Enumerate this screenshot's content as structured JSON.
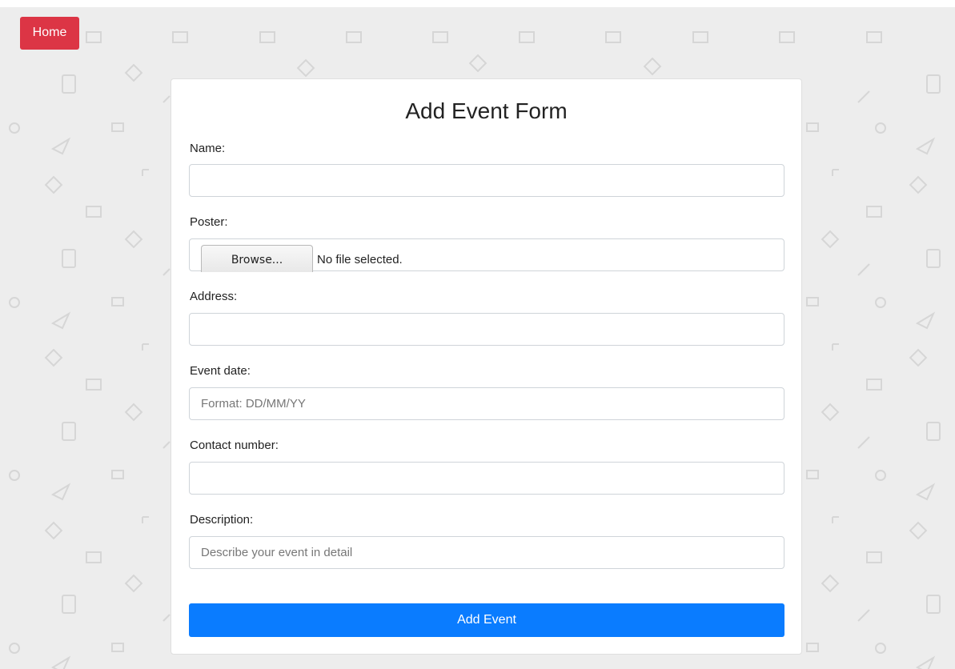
{
  "nav": {
    "home_label": "Home"
  },
  "form": {
    "title": "Add Event Form",
    "name": {
      "label": "Name:",
      "value": "",
      "placeholder": ""
    },
    "poster": {
      "label": "Poster:",
      "browse_label": "Browse...",
      "file_status": "No file selected."
    },
    "address": {
      "label": "Address:",
      "value": "",
      "placeholder": ""
    },
    "event_date": {
      "label": "Event date:",
      "value": "",
      "placeholder": "Format: DD/MM/YY"
    },
    "contact_number": {
      "label": "Contact number:",
      "value": "",
      "placeholder": ""
    },
    "description": {
      "label": "Description:",
      "value": "",
      "placeholder": "Describe your event in detail"
    },
    "submit_label": "Add Event"
  },
  "colors": {
    "home_button": "#dc3545",
    "submit_button": "#0a7cff",
    "background": "#ededed"
  },
  "background_icons": [
    "envelope-icon",
    "tablet-icon",
    "paper-plane-icon",
    "coffee-cup-icon",
    "tag-icon",
    "pencil-icon",
    "expand-icon"
  ]
}
